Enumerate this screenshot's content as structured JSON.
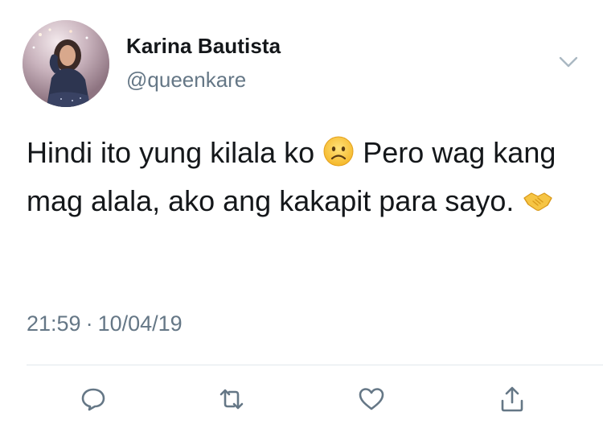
{
  "tweet": {
    "author": {
      "name": "Karina Bautista",
      "handle": "@queenkare"
    },
    "text": {
      "part1": "Hindi ito yung kilala ko ",
      "emoji1": "frowning-face-emoji",
      "part2": " Pero wag kang mag alala, ako ang kakapit para sayo. ",
      "emoji2": "handshake-emoji"
    },
    "timestamp": {
      "time": "21:59",
      "separator": "·",
      "date": "10/04/19"
    },
    "actions": {
      "reply_icon": "reply-icon",
      "retweet_icon": "retweet-icon",
      "like_icon": "heart-icon",
      "share_icon": "share-icon",
      "menu_icon": "chevron-down-icon"
    }
  },
  "colors": {
    "text_primary": "#14171a",
    "text_secondary": "#657786",
    "divider": "#e1e8ed",
    "icon": "#657786"
  }
}
